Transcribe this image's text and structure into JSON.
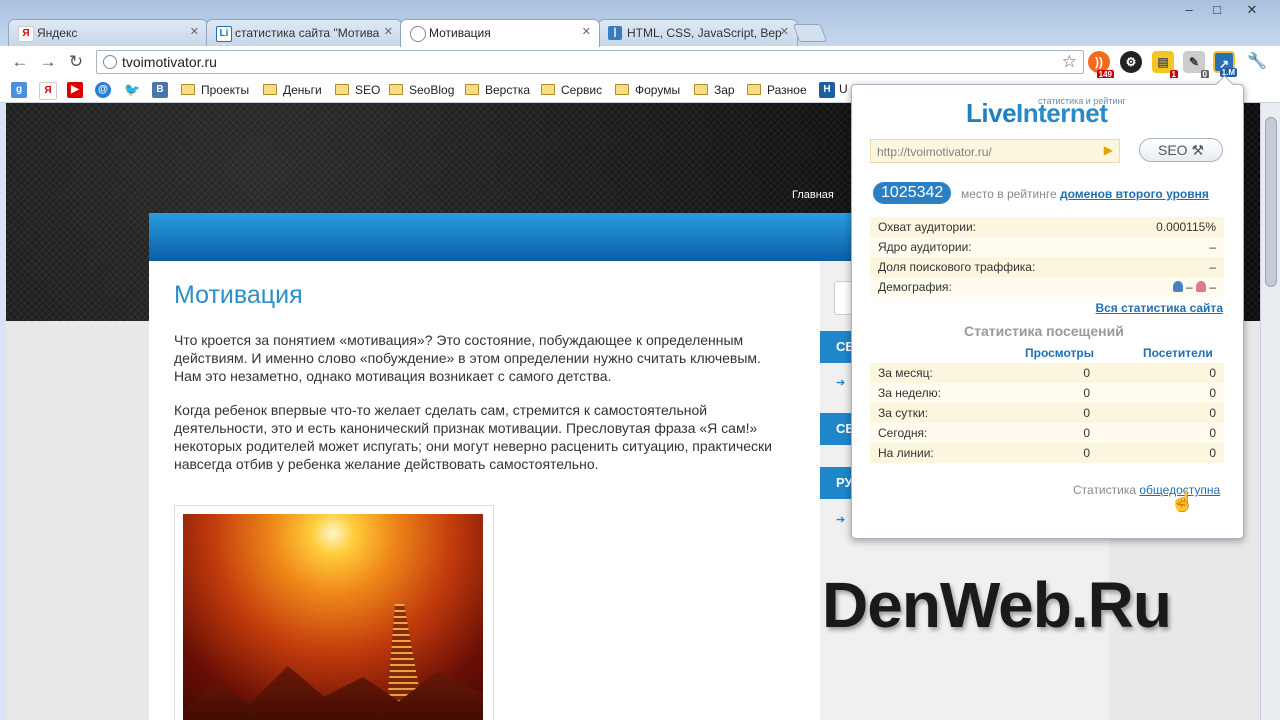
{
  "tabs": [
    {
      "label": "Яндекс",
      "icon": "yandex-icon",
      "active": false
    },
    {
      "label": "статистика сайта \"Мотива",
      "icon": "liveinternet-icon",
      "active": false
    },
    {
      "label": "Мотивация",
      "icon": "globe-icon",
      "active": true
    },
    {
      "label": "HTML, CSS, JavaScript, Вер",
      "icon": "book-icon",
      "active": false
    }
  ],
  "address_bar": {
    "url": "tvoimotivator.ru"
  },
  "extensions": {
    "badge_1": "149",
    "badge_2": "1",
    "badge_3": "0",
    "badge_4": "1.M"
  },
  "bookmarks": {
    "folders": [
      "Проекты",
      "Деньги",
      "SEO",
      "SeoBlog",
      "Верстка",
      "Сервис",
      "Форумы",
      "Зар",
      "Разное"
    ],
    "u_label": "U"
  },
  "site": {
    "nav_home": "Главная",
    "title": "Мотивация",
    "paragraph_1": "Что кроется за понятием «мотивация»? Это состояние, побуждающее к определенным действиям. И именно слово «побуждение» в этом определении нужно считать ключевым. Нам это незаметно, однако мотивация возникает с самого детства.",
    "paragraph_2": "Когда ребенок впервые что-то желает сделать сам, стремится к самостоятельной деятельности, это и есть канонический признак мотивации. Пресловутая фраза «Я сам!» некоторых родителей может испугать; они могут неверно расценить ситуацию, практически навсегда отбив у ребенка желание действовать самостоятельно.",
    "sidebar_tabs": [
      "СВ",
      "СВ",
      "РУ"
    ]
  },
  "watermark": "DenWeb.Ru",
  "popup": {
    "logo_live": "Live",
    "logo_internet": "Internet",
    "tagline": "статистика и рейтинг",
    "url": "http://tvoimotivator.ru/",
    "seo_button": "SEO",
    "rank": "1025342",
    "rank_text": "место в рейтинге",
    "rank_link": "доменов второго уровня",
    "audience": [
      {
        "label": "Охват аудитории:",
        "value": "0.000115%"
      },
      {
        "label": "Ядро аудитории:",
        "value": "–"
      },
      {
        "label": "Доля поискового траффика:",
        "value": "–"
      },
      {
        "label": "Демография:",
        "value": "–"
      }
    ],
    "demography_female": "–",
    "all_stats_link": "Вся статистика сайта",
    "visits_title": "Статистика посещений",
    "col_views": "Просмотры",
    "col_visitors": "Посетители",
    "visits": [
      {
        "label": "За месяц:",
        "views": "0",
        "visitors": "0"
      },
      {
        "label": "За неделю:",
        "views": "0",
        "visitors": "0"
      },
      {
        "label": "За сутки:",
        "views": "0",
        "visitors": "0"
      },
      {
        "label": "Сегодня:",
        "views": "0",
        "visitors": "0"
      },
      {
        "label": "На линии:",
        "views": "0",
        "visitors": "0"
      }
    ],
    "footer_text": "Статистика",
    "footer_link": "общедоступна"
  },
  "colors": {
    "accent": "#2b7fc4",
    "site_title": "#2b8fcb",
    "sidebar_tab": "#1f86c9"
  }
}
